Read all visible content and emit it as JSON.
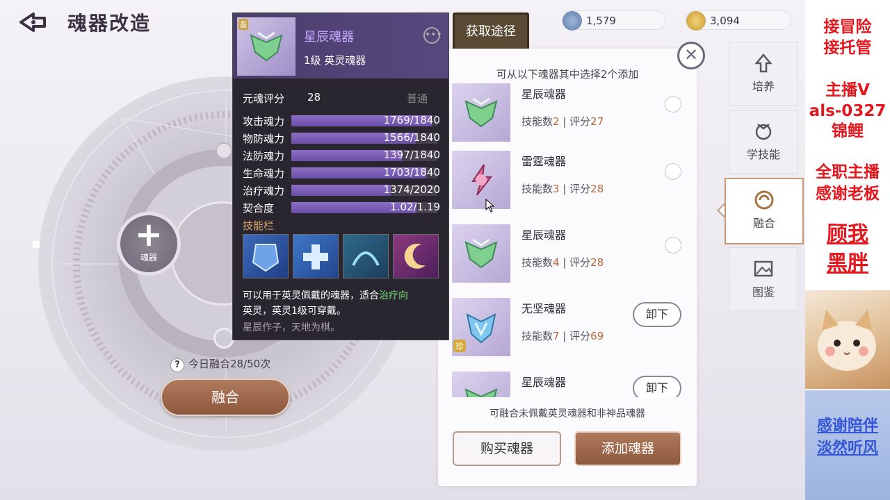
{
  "header": {
    "title": "魂器改造",
    "currency_1": "1,579",
    "currency_2": "3,094",
    "get_source_label": "获取途径"
  },
  "main": {
    "add_slot_label": "魂器",
    "today_fusion": "今日融合28/50次",
    "fuse_button": "融合"
  },
  "tooltip": {
    "badge": "晶",
    "name": "星辰魂器",
    "subtitle": "1级 英灵魂器",
    "score_label": "元魂评分",
    "score_value": "28",
    "score_rank": "普通",
    "stats": [
      {
        "name": "攻击魂力",
        "value": "1769/1840",
        "fraction": 0.961
      },
      {
        "name": "物防魂力",
        "value": "1566/1840",
        "fraction": 0.851
      },
      {
        "name": "法防魂力",
        "value": "1397/1840",
        "fraction": 0.759
      },
      {
        "name": "生命魂力",
        "value": "1703/1840",
        "fraction": 0.926
      },
      {
        "name": "治疗魂力",
        "value": "1374/2020",
        "fraction": 0.68
      },
      {
        "name": "契合度",
        "value": "1.02/1.19",
        "fraction": 0.857
      }
    ],
    "skills_label": "技能栏",
    "desc_part1": "可以用于英灵佩戴的魂器，适合",
    "desc_highlight": "治疗向",
    "desc_part2": "英灵，英灵1级可穿戴。",
    "flavor": "星辰作子，天地为棋。"
  },
  "panel": {
    "hint": "可从以下魂器其中选择2个添加",
    "footer_hint": "可融合未佩戴英灵魂器和非神品魂器",
    "buy_button": "购买魂器",
    "add_button": "添加魂器",
    "skill_prefix": "技能数",
    "score_prefix": "评分",
    "unload_label": "卸下",
    "items": [
      {
        "name": "星辰魂器",
        "skills": "2",
        "score": "27",
        "state": "radio"
      },
      {
        "name": "雷霆魂器",
        "skills": "3",
        "score": "28",
        "state": "radio"
      },
      {
        "name": "星辰魂器",
        "skills": "4",
        "score": "28",
        "state": "radio"
      },
      {
        "name": "无坚魂器",
        "skills": "7",
        "score": "69",
        "state": "unload",
        "badge": "珍"
      },
      {
        "name": "星辰魂器",
        "skills": "",
        "score": "",
        "state": "unload"
      }
    ]
  },
  "tabs": [
    {
      "label": "培养",
      "icon": "arrow-up-icon"
    },
    {
      "label": "学技能",
      "icon": "skill-icon"
    },
    {
      "label": "融合",
      "icon": "fusion-icon",
      "active": true
    },
    {
      "label": "图鉴",
      "icon": "gallery-icon"
    }
  ],
  "overlay": {
    "line1": "接冒险",
    "line2": "接托管",
    "line3": "主播V",
    "line4": "als-0327",
    "line5": "锦鲤",
    "line6": "全职主播",
    "line7": "感谢老板",
    "line8": "顾我",
    "line9": "黑胖",
    "line10": "感谢陪伴",
    "line11": "淡然听风"
  },
  "colors": {
    "accent": "#8e583e",
    "tooltip_bg": "#2a2630",
    "stat_fill": "#7a5cb5",
    "overlay_red": "#e3171e",
    "overlay_blue": "#3557d6"
  }
}
